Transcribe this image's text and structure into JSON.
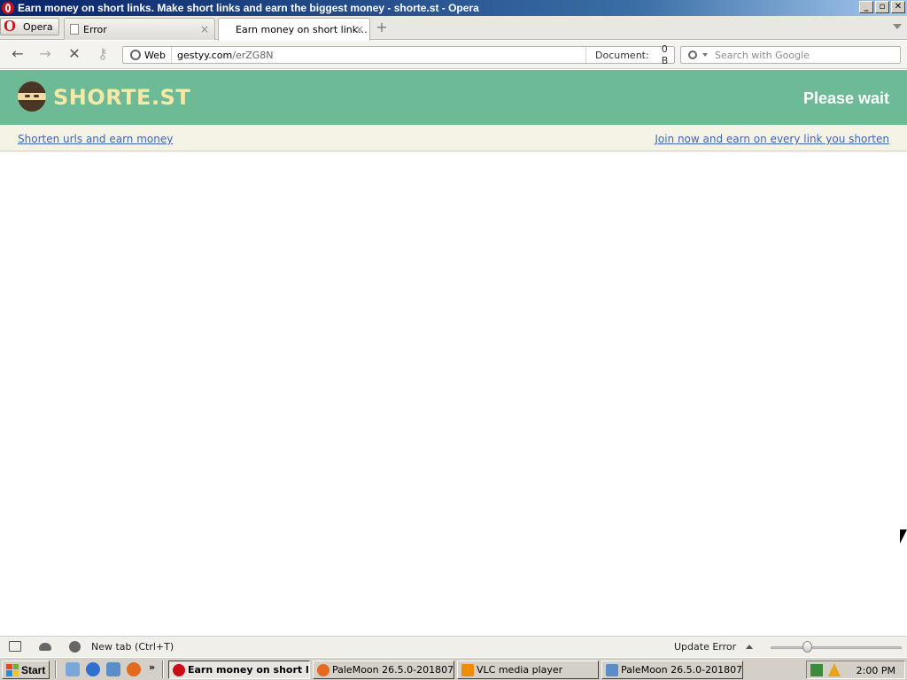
{
  "window": {
    "title": "Earn money on short links. Make short links and earn the biggest money - shorte.st - Opera",
    "minimize": "_",
    "maximize": "▫",
    "close": "✕"
  },
  "tabs": {
    "menu_label": "Opera",
    "items": [
      {
        "label": "Error",
        "active": false
      },
      {
        "label": "Earn money on short link...",
        "active": true
      }
    ],
    "close_glyph": "×",
    "new_tab_glyph": "+"
  },
  "nav": {
    "back": "←",
    "forward": "→",
    "stop": "✕",
    "key": "⚷",
    "web_badge": "Web",
    "url_host": "gestyy.com",
    "url_path": "/erZG8N",
    "document_label": "Document:",
    "document_size": "0 B",
    "search_placeholder": "Search with Google"
  },
  "page": {
    "brand": "SHORTE.ST",
    "please_wait": "Please wait",
    "left_link": "Shorten urls and earn money",
    "right_link": "Join now and earn on every link you shorten",
    "header_color": "#6cba96",
    "brand_color": "#f6e9a6"
  },
  "statusbar": {
    "status_text": "New tab (Ctrl+T)",
    "update": "Update Error"
  },
  "taskbar": {
    "start": "Start",
    "more": "»",
    "tasks": [
      {
        "label": "Earn money on short li...",
        "icon": "opera-icon",
        "active": true
      },
      {
        "label": "PaleMoon 26.5.0-201807...",
        "icon": "firefox-icon",
        "active": false
      },
      {
        "label": "VLC media player",
        "icon": "vlc-icon",
        "active": false
      },
      {
        "label": "PaleMoon 26.5.0-201807...",
        "icon": "document-icon",
        "active": false
      }
    ],
    "clock": "2:00 PM"
  }
}
